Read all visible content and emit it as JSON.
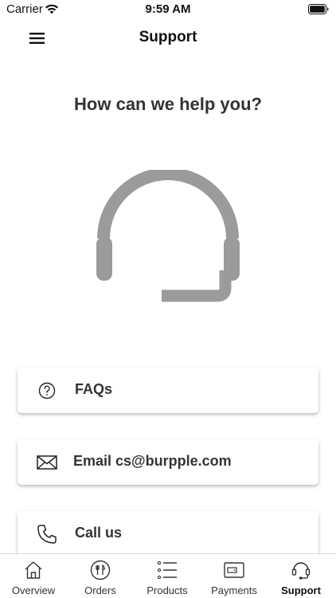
{
  "status_bar": {
    "carrier": "Carrier",
    "time": "9:59 AM",
    "wifi_icon": "wifi-icon",
    "battery_icon": "battery-icon"
  },
  "header": {
    "title": "Support",
    "menu_icon": "hamburger-menu-icon"
  },
  "main": {
    "headline": "How can we help you?",
    "hero_icon": "headset-icon",
    "hero_color": "#9b9b9b",
    "options": [
      {
        "label": "FAQs",
        "icon": "question-circle-icon"
      },
      {
        "label": "Email cs@burpple.com",
        "icon": "envelope-icon"
      },
      {
        "label": "Call us",
        "icon": "phone-icon"
      }
    ]
  },
  "tab_bar": {
    "active": "Support",
    "tabs": [
      {
        "label": "Overview",
        "icon": "home-icon"
      },
      {
        "label": "Orders",
        "icon": "utensils-plate-icon"
      },
      {
        "label": "Products",
        "icon": "list-icon"
      },
      {
        "label": "Payments",
        "icon": "wallet-icon"
      },
      {
        "label": "Support",
        "icon": "headset-icon"
      }
    ]
  }
}
